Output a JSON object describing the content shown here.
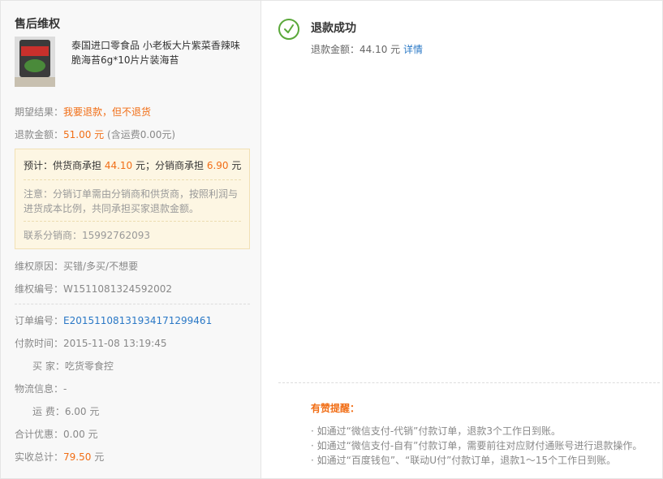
{
  "left": {
    "title": "售后维权",
    "product": {
      "name": "泰国进口零食品 小老板大片紫菜香辣味脆海苔6g*10片片装海苔",
      "thumb_icon": "product-thumbnail"
    },
    "expected_label": "期望结果：",
    "expected_value": "我要退款，但不退货",
    "refund_label": "退款金额：",
    "refund_amount": "51.00 元",
    "refund_note": "(含运费0.00元)",
    "notice": {
      "estimate_prefix": "预计：供货商承担 ",
      "supplier_amount": "44.10",
      "estimate_mid": " 元；分销商承担 ",
      "distributor_amount": "6.90",
      "estimate_suffix": " 元",
      "note": "注意：分销订单需由分销商和供货商，按照利润与进货成本比例，共同承担买家退款金额。",
      "contact": "联系分销商：15992762093"
    },
    "reason_label": "维权原因：",
    "reason_value": "买错/多买/不想要",
    "case_label": "维权编号：",
    "case_value": "W1511081324592002",
    "order_label": "订单编号：",
    "order_value": "E20151108131934171299461",
    "paytime_label": "付款时间：",
    "paytime_value": "2015-11-08 13:19:45",
    "buyer_label": "买 家：",
    "buyer_value": "吃货零食控",
    "logistics_label": "物流信息：",
    "logistics_value": "-",
    "shipping_label": "运 费：",
    "shipping_value": "6.00 元",
    "discount_label": "合计优惠：",
    "discount_value": "0.00 元",
    "total_label": "实收总计：",
    "total_amount": "79.50",
    "total_unit": " 元"
  },
  "right": {
    "status_title": "退款成功",
    "status_amount_text": "退款金额：44.10 元 ",
    "detail_link": "详情",
    "tips_title": "有赞提醒：",
    "tips": [
      "· 如通过“微信支付-代销”付款订单，退款3个工作日到账。",
      "· 如通过“微信支付-自有”付款订单，需要前往对应财付通账号进行退款操作。",
      "· 如通过“百度钱包”、“联动U付”付款订单，退款1～15个工作日到账。"
    ]
  },
  "colors": {
    "accent_orange": "#f16e16",
    "link_blue": "#2a78c6",
    "success_green": "#5aa83a",
    "notice_bg": "#fdf6e3"
  }
}
